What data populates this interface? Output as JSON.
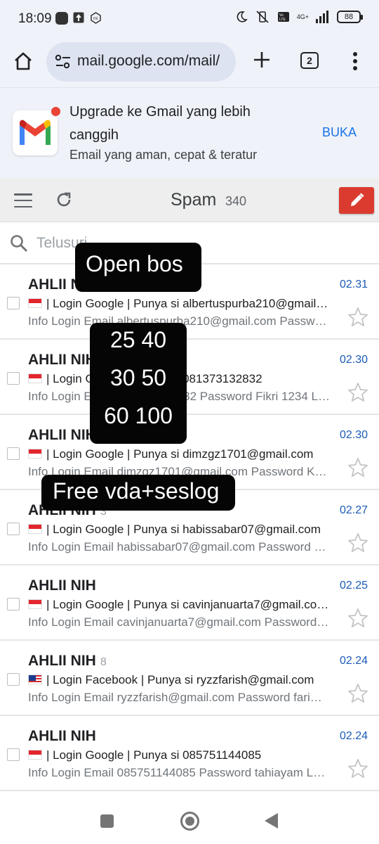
{
  "status_bar": {
    "time": "18:09",
    "network": "4G+",
    "battery": "88"
  },
  "browser": {
    "url": "mail.google.com/mail/",
    "tab_count": "2"
  },
  "promo": {
    "title": "Upgrade ke Gmail yang lebih canggih",
    "subtitle": "Email yang aman, cepat & teratur",
    "open_label": "BUKA"
  },
  "header": {
    "folder": "Spam",
    "count": "340"
  },
  "search": {
    "placeholder": "Telusuri"
  },
  "emails": [
    {
      "sender": "AHLII NIH",
      "count": "",
      "time": "02.31",
      "flag": "id",
      "subject": "| Login Google | Punya si albertuspurba210@gmail…",
      "snippet": "Info Login Email albertuspurba210@gmail.com Passw…"
    },
    {
      "sender": "AHLII NIH",
      "count": "",
      "time": "02.30",
      "flag": "id",
      "subject": "| Login Google | Punya si 081373132832",
      "snippet": "Info Login Email 081373132832 Password Fikri 1234 L…"
    },
    {
      "sender": "AHLII NIH",
      "count": "",
      "time": "02.30",
      "flag": "id",
      "subject": "| Login Google | Punya si dimzgz1701@gmail.com",
      "snippet": "Info Login Email dimzgz1701@gmail.com Password K…"
    },
    {
      "sender": "AHLII NIH",
      "count": "3",
      "time": "02.27",
      "flag": "id",
      "subject": "| Login Google | Punya si habissabar07@gmail.com",
      "snippet": "Info Login Email habissabar07@gmail.com Password …"
    },
    {
      "sender": "AHLII NIH",
      "count": "",
      "time": "02.25",
      "flag": "id",
      "subject": "| Login Google | Punya si cavinjanuarta7@gmail.co…",
      "snippet": "Info Login Email cavinjanuarta7@gmail.com Password…"
    },
    {
      "sender": "AHLII NIH",
      "count": "8",
      "time": "02.24",
      "flag": "my",
      "subject": "| Login Facebook | Punya si ryzzfarish@gmail.com",
      "snippet": "Info Login Email ryzzfarish@gmail.com Password fari…"
    },
    {
      "sender": "AHLII NIH",
      "count": "",
      "time": "02.24",
      "flag": "id",
      "subject": "| Login Google | Punya si 085751144085",
      "snippet": "Info Login Email 085751144085 Password tahiayam L…"
    }
  ],
  "overlays": {
    "open": "Open bos",
    "prices": [
      "25 40",
      "30 50",
      "60 100"
    ],
    "free": "Free vda+seslog"
  },
  "colors": {
    "accent_blue": "#1a73e8",
    "time_blue": "#1a5bb5",
    "compose_red": "#db3b2f",
    "chrome_bg": "#eff2f9"
  }
}
